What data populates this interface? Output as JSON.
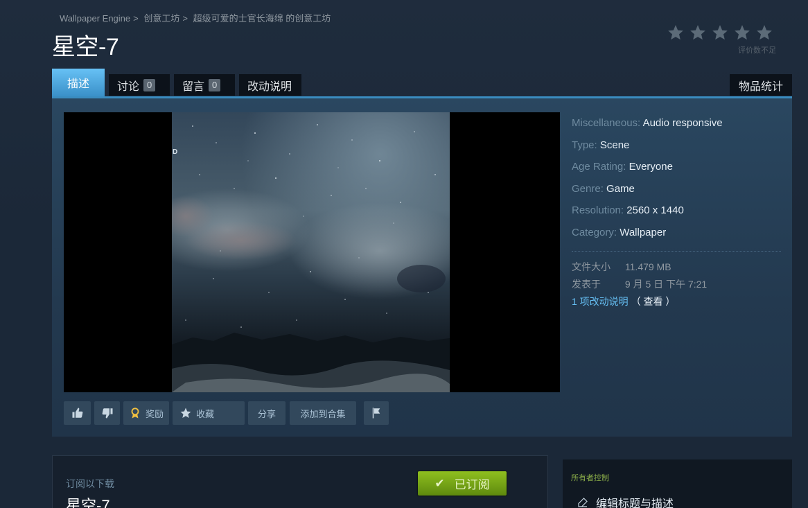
{
  "breadcrumb": {
    "app": "Wallpaper Engine",
    "workshop": "创意工坊",
    "author_workshop": "超级可爱的士官长海绵 的创意工坊",
    "separator": ">"
  },
  "page_title": "星空-7",
  "rating": {
    "stars_filled": 0,
    "stars_total": 5,
    "text": "评价数不足"
  },
  "tabs": {
    "description": "描述",
    "discussions": "讨论",
    "discussions_count": "0",
    "comments": "留言",
    "comments_count": "0",
    "change_notes": "改动说明",
    "stats": "物品统计"
  },
  "preview": {
    "overlay_text": "D"
  },
  "details": [
    {
      "key": "Miscellaneous:",
      "value": "Audio responsive"
    },
    {
      "key": "Type:",
      "value": "Scene"
    },
    {
      "key": "Age Rating:",
      "value": "Everyone"
    },
    {
      "key": "Genre:",
      "value": "Game"
    },
    {
      "key": "Resolution:",
      "value": "2560 x 1440"
    },
    {
      "key": "Category:",
      "value": "Wallpaper"
    }
  ],
  "meta": {
    "file_size_label": "文件大小",
    "file_size_value": "11.479 MB",
    "posted_label": "发表于",
    "posted_value": "9 月 5 日 下午 7:21",
    "change_notes_link": "1 项改动说明",
    "view_link": "（ 查看 ）"
  },
  "actions": {
    "award": "奖励",
    "favorite": "收藏",
    "share": "分享",
    "add_to_collection": "添加到合集"
  },
  "subscribe": {
    "label": "订阅以下载",
    "title": "星空-7",
    "button": "已订阅"
  },
  "owner_controls": {
    "label": "所有者控制",
    "edit_title": "编辑标题与描述"
  }
}
